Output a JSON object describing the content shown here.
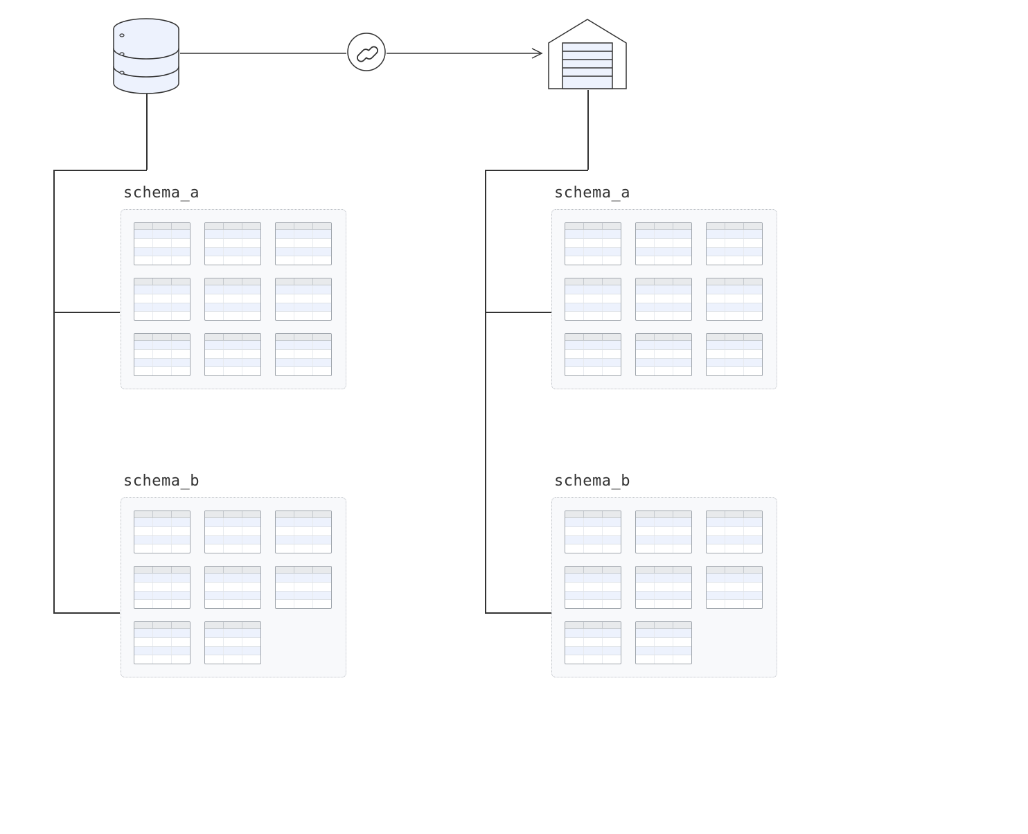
{
  "nodes": {
    "source": {
      "type": "database"
    },
    "target": {
      "type": "warehouse"
    },
    "connector": {
      "type": "link"
    }
  },
  "source_schemas": [
    {
      "name": "schema_a",
      "table_count": 9
    },
    {
      "name": "schema_b",
      "table_count": 8
    }
  ],
  "target_schemas": [
    {
      "name": "schema_a",
      "table_count": 9
    },
    {
      "name": "schema_b",
      "table_count": 8
    }
  ]
}
